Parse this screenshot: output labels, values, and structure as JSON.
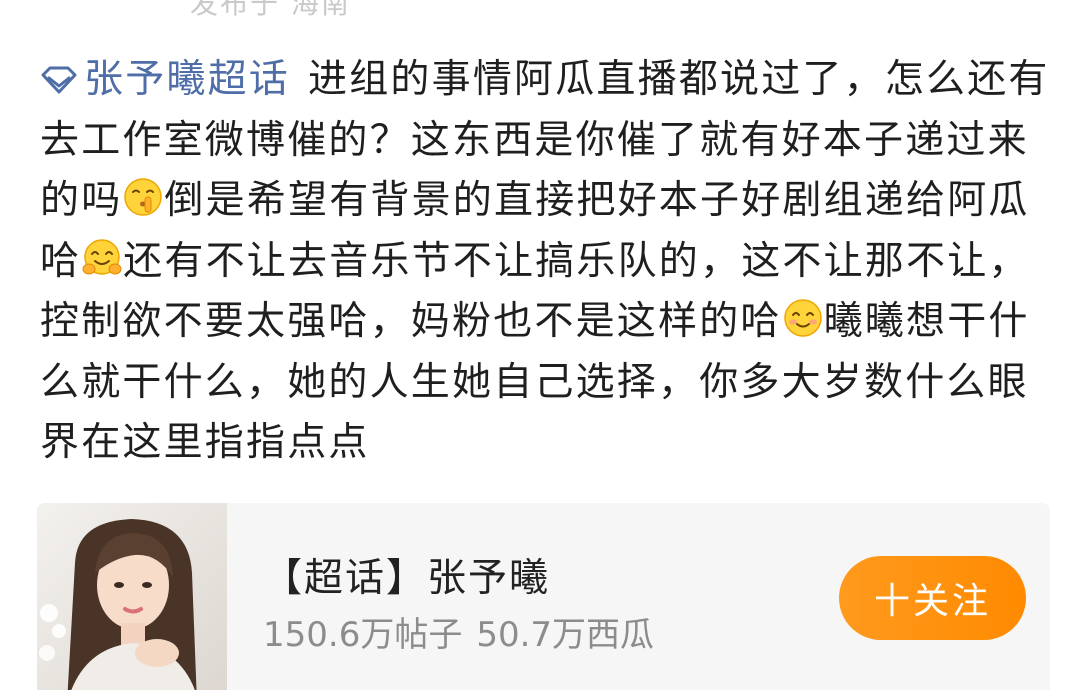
{
  "header": {
    "location_text": "发布于 海南"
  },
  "post": {
    "topic_tag": "张予曦超话",
    "segments": [
      {
        "type": "text",
        "value": "进组的事情阿瓜直播都说过了，怎么还有去工作室微博催的？这东西是你催了就有好本子递过来的吗"
      },
      {
        "type": "emoji",
        "name": "shush-emoji"
      },
      {
        "type": "text",
        "value": "倒是希望有背景的直接把好本子好剧组递给阿瓜哈"
      },
      {
        "type": "emoji",
        "name": "hug-emoji"
      },
      {
        "type": "text",
        "value": "还有不让去音乐节不让搞乐队的，这不让那不让，控制欲不要太强哈，妈粉也不是这样的哈"
      },
      {
        "type": "emoji",
        "name": "smile-emoji"
      },
      {
        "type": "text",
        "value": "曦曦想干什么就干什么，她的人生她自己选择，你多大岁数什么眼界在这里指指点点"
      }
    ]
  },
  "card": {
    "title": "【超话】张予曦",
    "posts_count": "150.6万帖子",
    "fans_count": "50.7万西瓜",
    "follow_label": "十关注"
  },
  "colors": {
    "topic_link": "#4f6ea8",
    "follow_button": "#ff9000",
    "card_background": "#f6f6f6"
  }
}
